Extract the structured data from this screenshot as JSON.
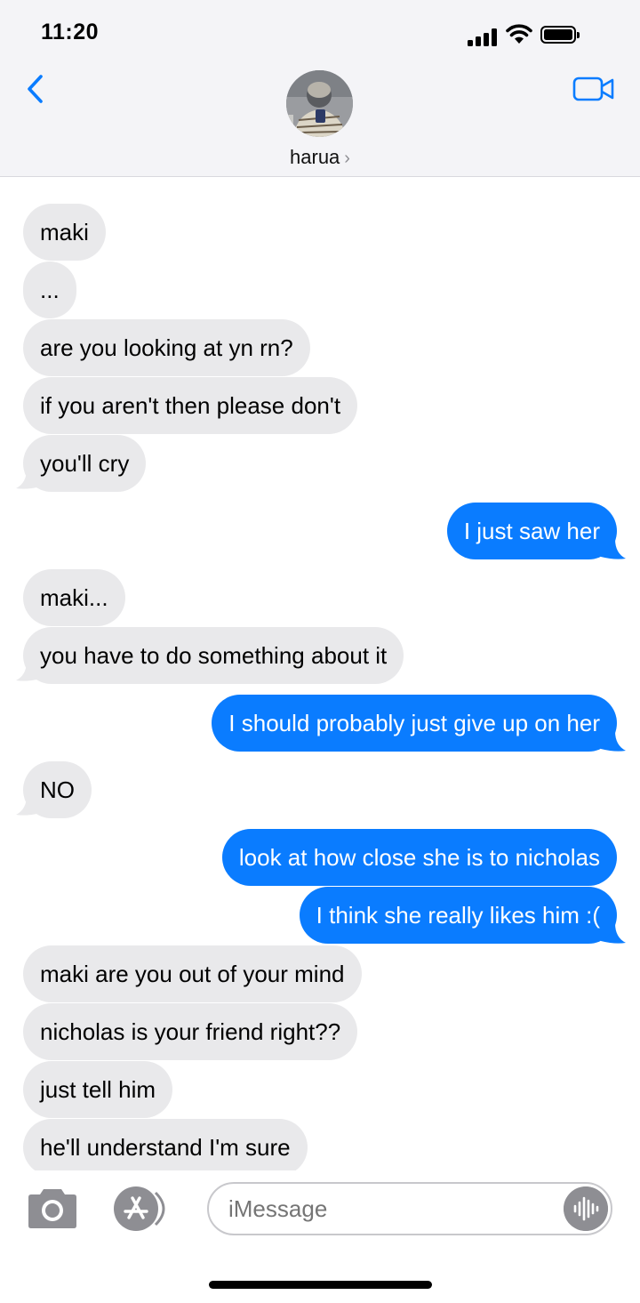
{
  "status_bar": {
    "time": "11:20"
  },
  "header": {
    "contact_name": "harua",
    "accent_color": "#0a7cff"
  },
  "messages": [
    {
      "side": "received",
      "text": "maki"
    },
    {
      "side": "received",
      "text": "..."
    },
    {
      "side": "received",
      "text": "are you looking at yn rn?"
    },
    {
      "side": "received",
      "text": "if you aren't then please don't"
    },
    {
      "side": "received",
      "text": "you'll cry"
    },
    {
      "side": "sent",
      "text": "I just saw her"
    },
    {
      "side": "received",
      "text": "maki..."
    },
    {
      "side": "received",
      "text": "you have to do something about it"
    },
    {
      "side": "sent",
      "text": "I should probably just give up on her"
    },
    {
      "side": "received",
      "text": "NO"
    },
    {
      "side": "sent",
      "text": "look at how close she is to nicholas"
    },
    {
      "side": "sent",
      "text": "I think she really likes him :("
    },
    {
      "side": "received",
      "text": "maki are you out of your mind"
    },
    {
      "side": "received",
      "text": "nicholas is your friend right??"
    },
    {
      "side": "received",
      "text": "just tell him"
    },
    {
      "side": "received",
      "text": "he'll understand I'm sure"
    }
  ],
  "input": {
    "placeholder": "iMessage",
    "icons": [
      "camera-icon",
      "app-store-icon",
      "audio-waveform-icon"
    ]
  }
}
